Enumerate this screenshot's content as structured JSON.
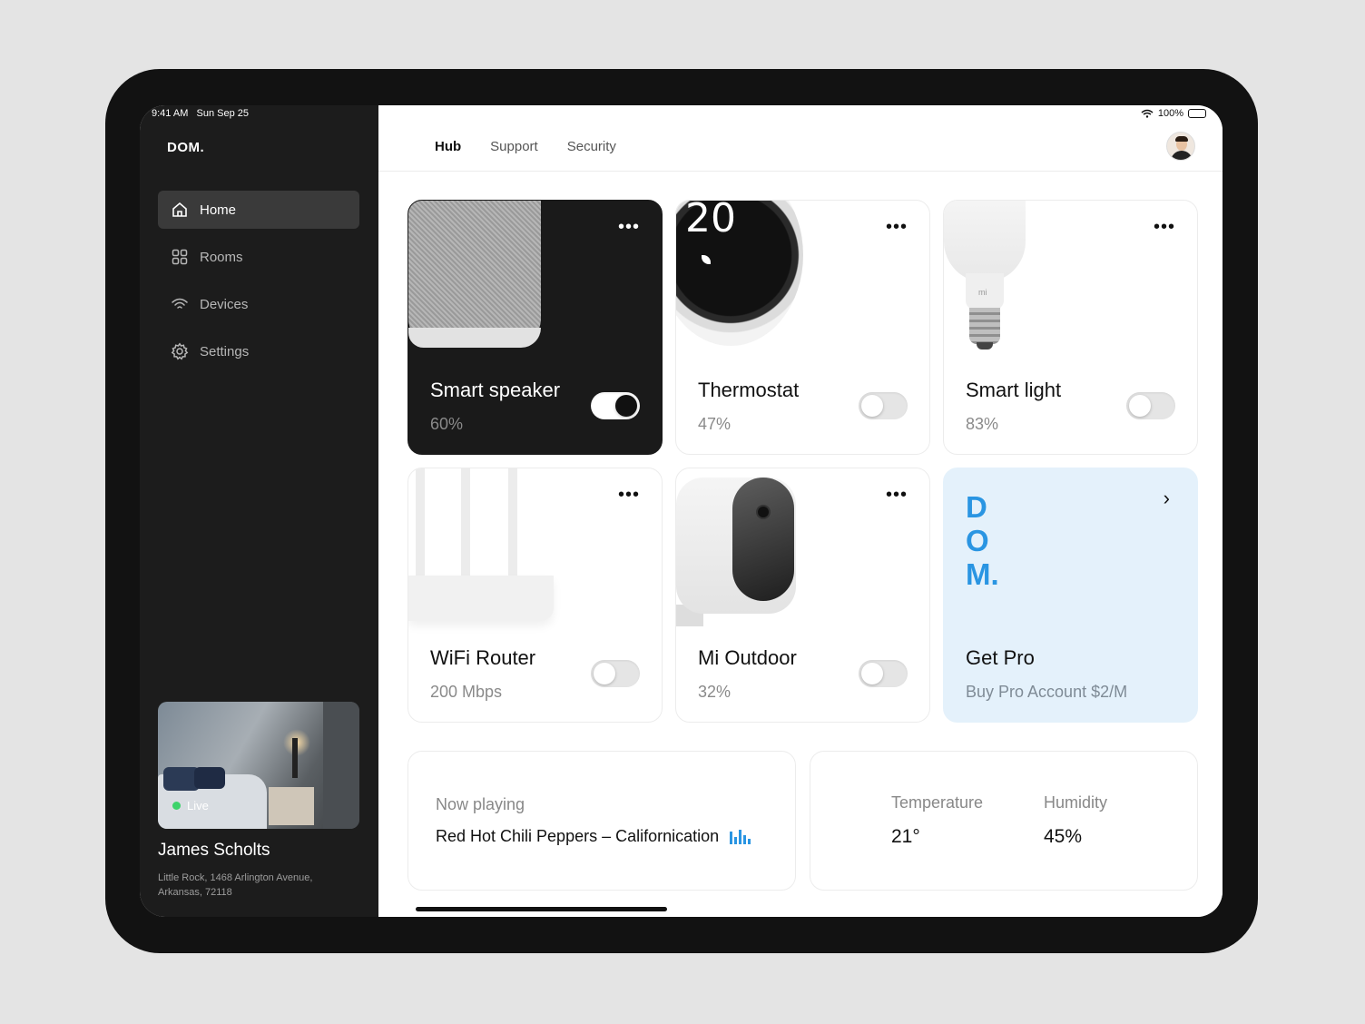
{
  "status": {
    "time": "9:41 AM",
    "date": "Sun Sep 25",
    "battery": "100%"
  },
  "sidebar": {
    "brand": "DOM.",
    "items": [
      {
        "label": "Home",
        "icon": "home-icon",
        "active": true
      },
      {
        "label": "Rooms",
        "icon": "grid-icon"
      },
      {
        "label": "Devices",
        "icon": "wifi-icon"
      },
      {
        "label": "Settings",
        "icon": "gear-icon"
      }
    ],
    "camera": {
      "status": "Live"
    },
    "user": {
      "name": "James Scholts",
      "address": "Little Rock, 1468 Arlington Avenue, Arkansas, 72118"
    }
  },
  "header": {
    "tabs": [
      {
        "label": "Hub",
        "active": true
      },
      {
        "label": "Support"
      },
      {
        "label": "Security"
      }
    ]
  },
  "devices": [
    {
      "name": "Smart speaker",
      "value": "60%",
      "on": true
    },
    {
      "name": "Thermostat",
      "value": "47%",
      "on": false,
      "display": "20"
    },
    {
      "name": "Smart light",
      "value": "83%",
      "on": false,
      "logo": "mi"
    },
    {
      "name": "WiFi Router",
      "value": "200 Mbps",
      "on": false
    },
    {
      "name": "Mi Outdoor",
      "value": "32%",
      "on": false
    }
  ],
  "promo": {
    "logo_lines": [
      "D",
      "O",
      "M."
    ],
    "title": "Get Pro",
    "subtitle": "Buy Pro Account $2/M"
  },
  "now_playing": {
    "label": "Now playing",
    "song": "Red Hot Chili Peppers – Californication"
  },
  "climate": {
    "temperature_label": "Temperature",
    "temperature": "21°",
    "humidity_label": "Humidity",
    "humidity": "45%"
  },
  "colors": {
    "accent": "#2a95e2",
    "sidebar_bg": "#1c1c1c",
    "promo_bg": "#e4f1fb",
    "live_dot": "#3ed36b"
  }
}
